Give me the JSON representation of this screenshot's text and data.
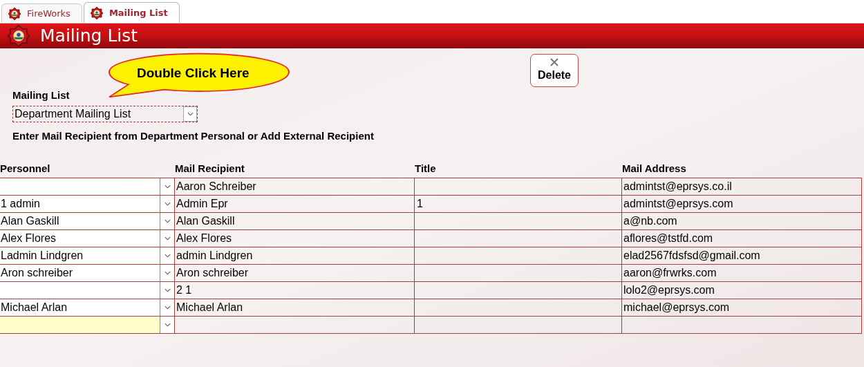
{
  "tabs": [
    {
      "label": "FireWorks",
      "selected": false
    },
    {
      "label": "Mailing List",
      "selected": true
    }
  ],
  "header": {
    "title": "Mailing List"
  },
  "callout": {
    "text": "Double Click Here"
  },
  "delete_button": {
    "label": "Delete"
  },
  "mailing_list": {
    "label": "Mailing List",
    "value": "Department Mailing List"
  },
  "instruction": "Enter Mail Recipient from Department Personal or Add External Recipient",
  "table": {
    "columns": [
      "Personnel",
      "Mail Recipient",
      "Title",
      "Mail Address"
    ],
    "rows": [
      {
        "kind": "record",
        "recipient": "Aaron Schreiber",
        "address": "admintst@eprsys.co.il"
      },
      {
        "kind": "record",
        "personnel": "1 admin",
        "recipient": "Admin Epr",
        "title": "1",
        "address": "admintst@eprsys.com"
      },
      {
        "kind": "record",
        "personnel": "Alan Gaskill",
        "recipient": "Alan Gaskill",
        "address": "a@nb.com"
      },
      {
        "kind": "record",
        "personnel": "Alex Flores",
        "recipient": "Alex Flores",
        "address": "aflores@tstfd.com"
      },
      {
        "kind": "record",
        "personnel": "Ladmin Lindgren",
        "recipient": "admin Lindgren",
        "address": "elad2567fdsfsd@gmail.com"
      },
      {
        "kind": "record",
        "personnel": "Aron schreiber",
        "recipient": "Aron schreiber",
        "address": "aaron@frwrks.com"
      },
      {
        "kind": "record",
        "recipient": "2 1",
        "address": "lolo2@eprsys.com"
      },
      {
        "kind": "record",
        "personnel": "Michael Arlan",
        "recipient": "Michael Arlan",
        "address": "michael@eprsys.com"
      },
      {
        "kind": "new"
      }
    ]
  }
}
